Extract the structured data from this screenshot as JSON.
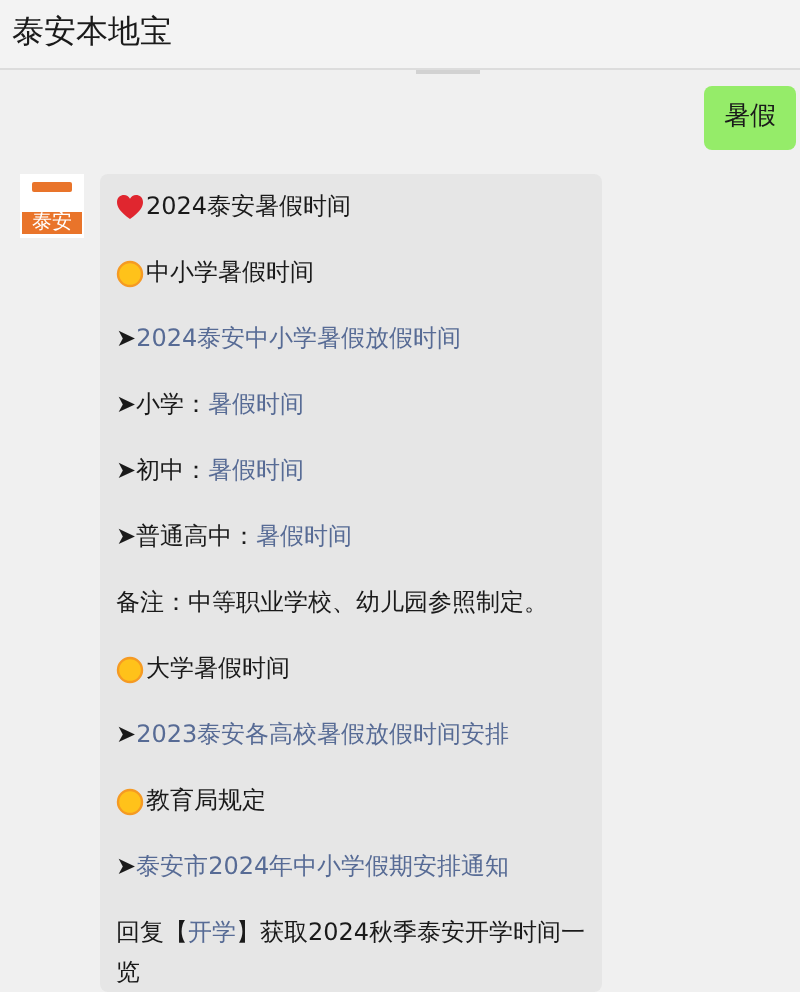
{
  "header": {
    "title": "泰安本地宝"
  },
  "messages": [
    {
      "kind": "sent",
      "text": "暑假"
    },
    {
      "kind": "received",
      "avatar": {
        "label": "泰安"
      },
      "lines": [
        {
          "kind": "heart",
          "segments": [
            {
              "text": "2024泰安暑假时间"
            }
          ]
        },
        {
          "kind": "sun",
          "segments": [
            {
              "text": "中小学暑假时间"
            }
          ]
        },
        {
          "kind": "plain",
          "segments": [
            {
              "text": "➤"
            },
            {
              "text": "2024泰安中小学暑假放假时间",
              "link": true
            }
          ]
        },
        {
          "kind": "plain",
          "segments": [
            {
              "text": "➤小学："
            },
            {
              "text": "暑假时间",
              "link": true
            }
          ]
        },
        {
          "kind": "plain",
          "segments": [
            {
              "text": "➤初中："
            },
            {
              "text": "暑假时间",
              "link": true
            }
          ]
        },
        {
          "kind": "plain",
          "segments": [
            {
              "text": "➤普通高中："
            },
            {
              "text": "暑假时间",
              "link": true
            }
          ]
        },
        {
          "kind": "plain",
          "segments": [
            {
              "text": "备注：中等职业学校、幼儿园参照制定。"
            }
          ]
        },
        {
          "kind": "sun",
          "segments": [
            {
              "text": "大学暑假时间"
            }
          ]
        },
        {
          "kind": "plain",
          "segments": [
            {
              "text": "➤"
            },
            {
              "text": "2023泰安各高校暑假放假时间安排",
              "link": true
            }
          ]
        },
        {
          "kind": "sun",
          "segments": [
            {
              "text": "教育局规定"
            }
          ]
        },
        {
          "kind": "plain",
          "segments": [
            {
              "text": "➤"
            },
            {
              "text": "泰安市2024年中小学假期安排通知",
              "link": true
            }
          ]
        },
        {
          "kind": "plain",
          "segments": [
            {
              "text": "回复【"
            },
            {
              "text": "开学",
              "link": true
            },
            {
              "text": "】获取2024秋季泰安开学时间一览"
            }
          ]
        }
      ]
    }
  ]
}
